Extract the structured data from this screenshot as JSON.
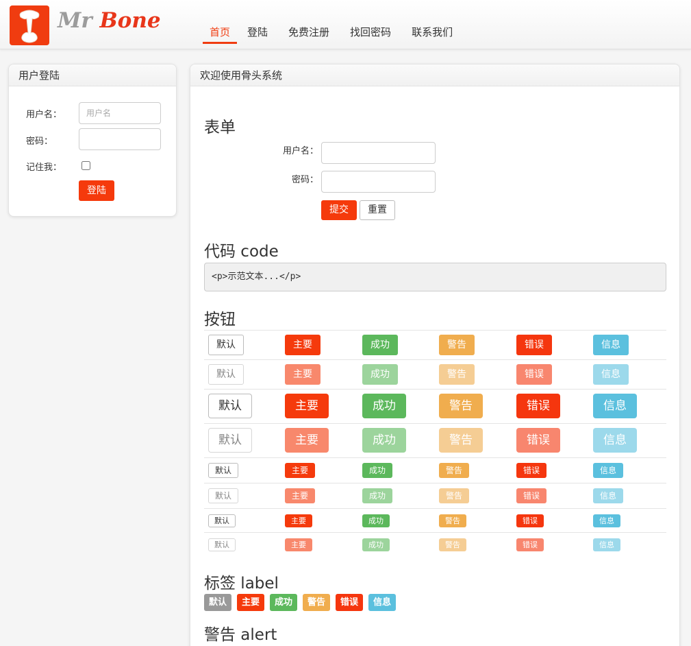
{
  "brand": {
    "part1": "Mr",
    "part2": "Bone"
  },
  "nav": [
    {
      "label": "首页",
      "active": true
    },
    {
      "label": "登陆"
    },
    {
      "label": "免费注册"
    },
    {
      "label": "找回密码"
    },
    {
      "label": "联系我们"
    }
  ],
  "sidebar": {
    "title": "用户登陆",
    "username_label": "用户名：",
    "username_placeholder": "用户名",
    "password_label": "密码：",
    "remember_label": "记住我：",
    "login_button": "登陆"
  },
  "main": {
    "title": "欢迎使用骨头系统",
    "form_heading": "表单",
    "form": {
      "username_label": "用户名：",
      "password_label": "密码：",
      "submit_button": "提交",
      "reset_button": "重置"
    },
    "code_heading": "代码 code",
    "code_sample": "<p>示范文本...</p>",
    "buttons_heading": "按钮",
    "button_labels": [
      "默认",
      "主要",
      "成功",
      "警告",
      "错误",
      "信息"
    ],
    "label_heading": "标签 label",
    "labels": [
      "默认",
      "主要",
      "成功",
      "警告",
      "错误",
      "信息"
    ],
    "alert_heading": "警告 alert"
  },
  "colors": {
    "brand": "#f03c10",
    "default": "#ffffff",
    "primary": "#f53a0c",
    "success": "#5cb85c",
    "warning": "#f0ad4e",
    "danger": "#f5360e",
    "info": "#5bc0de",
    "label_default": "#999999"
  }
}
